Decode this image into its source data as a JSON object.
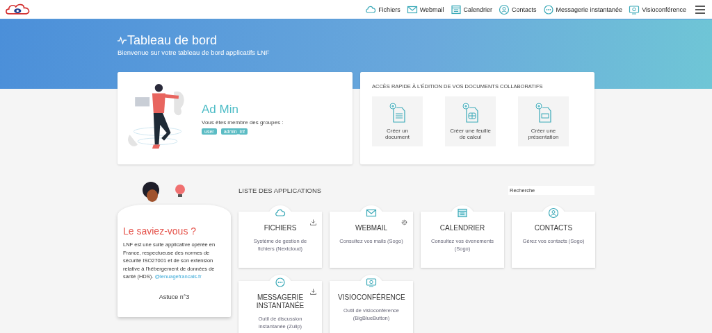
{
  "nav": [
    {
      "label": "Fichiers",
      "kind": "cloud"
    },
    {
      "label": "Webmail",
      "kind": "mail"
    },
    {
      "label": "Calendrier",
      "kind": "calendar"
    },
    {
      "label": "Contacts",
      "kind": "contacts"
    },
    {
      "label": "Messagerie instantanée",
      "kind": "chat"
    },
    {
      "label": "Visioconférence",
      "kind": "video"
    }
  ],
  "hero": {
    "title": "Tableau de bord",
    "subtitle": "Bienvenue sur votre tableau de bord applicatifs LNF"
  },
  "profile": {
    "name": "Ad Min",
    "groups_label": "Vous êtes membre des groupes :",
    "groups": [
      "user",
      "admin_lnf"
    ]
  },
  "quick_access": {
    "title": "ACCÈS RAPIDE À L'ÉDITION DE VOS DOCUMENTS COLLABORATIFS",
    "items": [
      {
        "label": "Créer un document",
        "kind": "text"
      },
      {
        "label": "Créer une feuille de calcul",
        "kind": "sheet"
      },
      {
        "label": "Créer une présentation",
        "kind": "slides"
      }
    ]
  },
  "tip": {
    "title": "Le saviez-vous ?",
    "text": "LNF est une suite applicative opérée en France, respectueuse des normes de sécurité ISO27001 et de son extension relative à l'hébergement de données de santé (HDS).",
    "link": "@lenuagefrancais.fr",
    "footer": "Astuce n°3"
  },
  "apps": {
    "title": "LISTE DES APPLICATIONS",
    "search": {
      "placeholder": "Recherche"
    },
    "items": [
      {
        "name": "FICHIERS",
        "description": "Système de gestion de fichiers (Nextcloud)",
        "kind": "cloud",
        "download": true,
        "settings": false
      },
      {
        "name": "WEBMAIL",
        "description": "Consultez vos mails (Sogo)",
        "kind": "mail",
        "download": false,
        "settings": true
      },
      {
        "name": "CALENDRIER",
        "description": "Consultez vos évenements (Sogo)",
        "kind": "calendar",
        "download": false,
        "settings": false
      },
      {
        "name": "CONTACTS",
        "description": "Gérez vos contacts (Sogo)",
        "kind": "contacts",
        "download": false,
        "settings": false
      },
      {
        "name": "MESSAGERIE INSTANTANÉE",
        "description": "Outil de discussion instantanée (Zulip)",
        "kind": "chat",
        "download": true,
        "settings": false
      },
      {
        "name": "VISIOCONFÉRENCE",
        "description": "Outil de visioconférence (BigBlueButton)",
        "kind": "video",
        "download": false,
        "settings": false
      }
    ]
  }
}
